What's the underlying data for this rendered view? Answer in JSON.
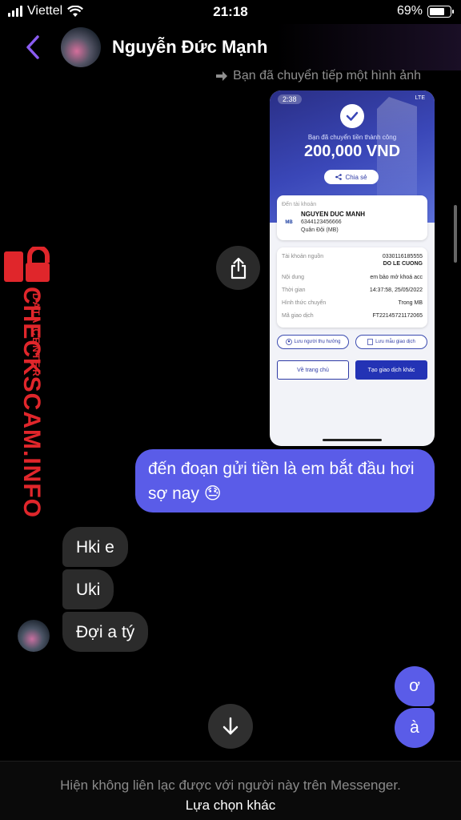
{
  "status_bar": {
    "carrier": "Viettel",
    "time": "21:18",
    "battery": "69%"
  },
  "header": {
    "contact_name": "Nguyễn Đức Mạnh"
  },
  "forward_note": "Bạn đã chuyển tiếp một hình ảnh",
  "receipt": {
    "phone_time": "2:38",
    "network": "LTE",
    "success_text": "Bạn đã chuyển tiền thành công",
    "amount": "200,000 VND",
    "share_label": "Chia sẻ",
    "to_account_label": "Đến tài khoản",
    "recipient_name": "NGUYEN DUC MANH",
    "recipient_account": "6344123456666",
    "recipient_bank": "Quân Đội (MB)",
    "bank_logo": "MB",
    "details": [
      {
        "label": "Tài khoản nguồn",
        "value": "0330116185555"
      },
      {
        "label": "",
        "value": "DO LE CUONG"
      },
      {
        "label": "Nội dung",
        "value": "em bảo mở khoá acc"
      },
      {
        "label": "Thời gian",
        "value": "14:37:58, 25/05/2022"
      },
      {
        "label": "Hình thức chuyển",
        "value": "Trong MB"
      },
      {
        "label": "Mã giao dịch",
        "value": "FT22145721172065"
      }
    ],
    "save_recipient": "Lưu người thụ hưởng",
    "save_template": "Lưu mẫu giao dịch",
    "home_button": "Về trang chủ",
    "new_transaction": "Tạo giao dịch khác"
  },
  "watermark": {
    "main": "CHECKSCAM.INFO",
    "sub": "DATA CENTER"
  },
  "messages": {
    "sent_1": "đến đoạn gửi tiền là em bắt đầu hơi sợ nay 😓",
    "recv_1": "Hki e",
    "recv_2": "Uki",
    "recv_3": "Đợi a tý",
    "sent_2": "ơ",
    "sent_3": "à"
  },
  "footer": {
    "notice": "Hiện không liên lạc được với người này trên Messenger.",
    "option": "Lựa chọn khác"
  },
  "colors": {
    "accent": "#5a5ce8",
    "back_arrow": "#8a5cf0",
    "watermark": "#e0262b"
  }
}
